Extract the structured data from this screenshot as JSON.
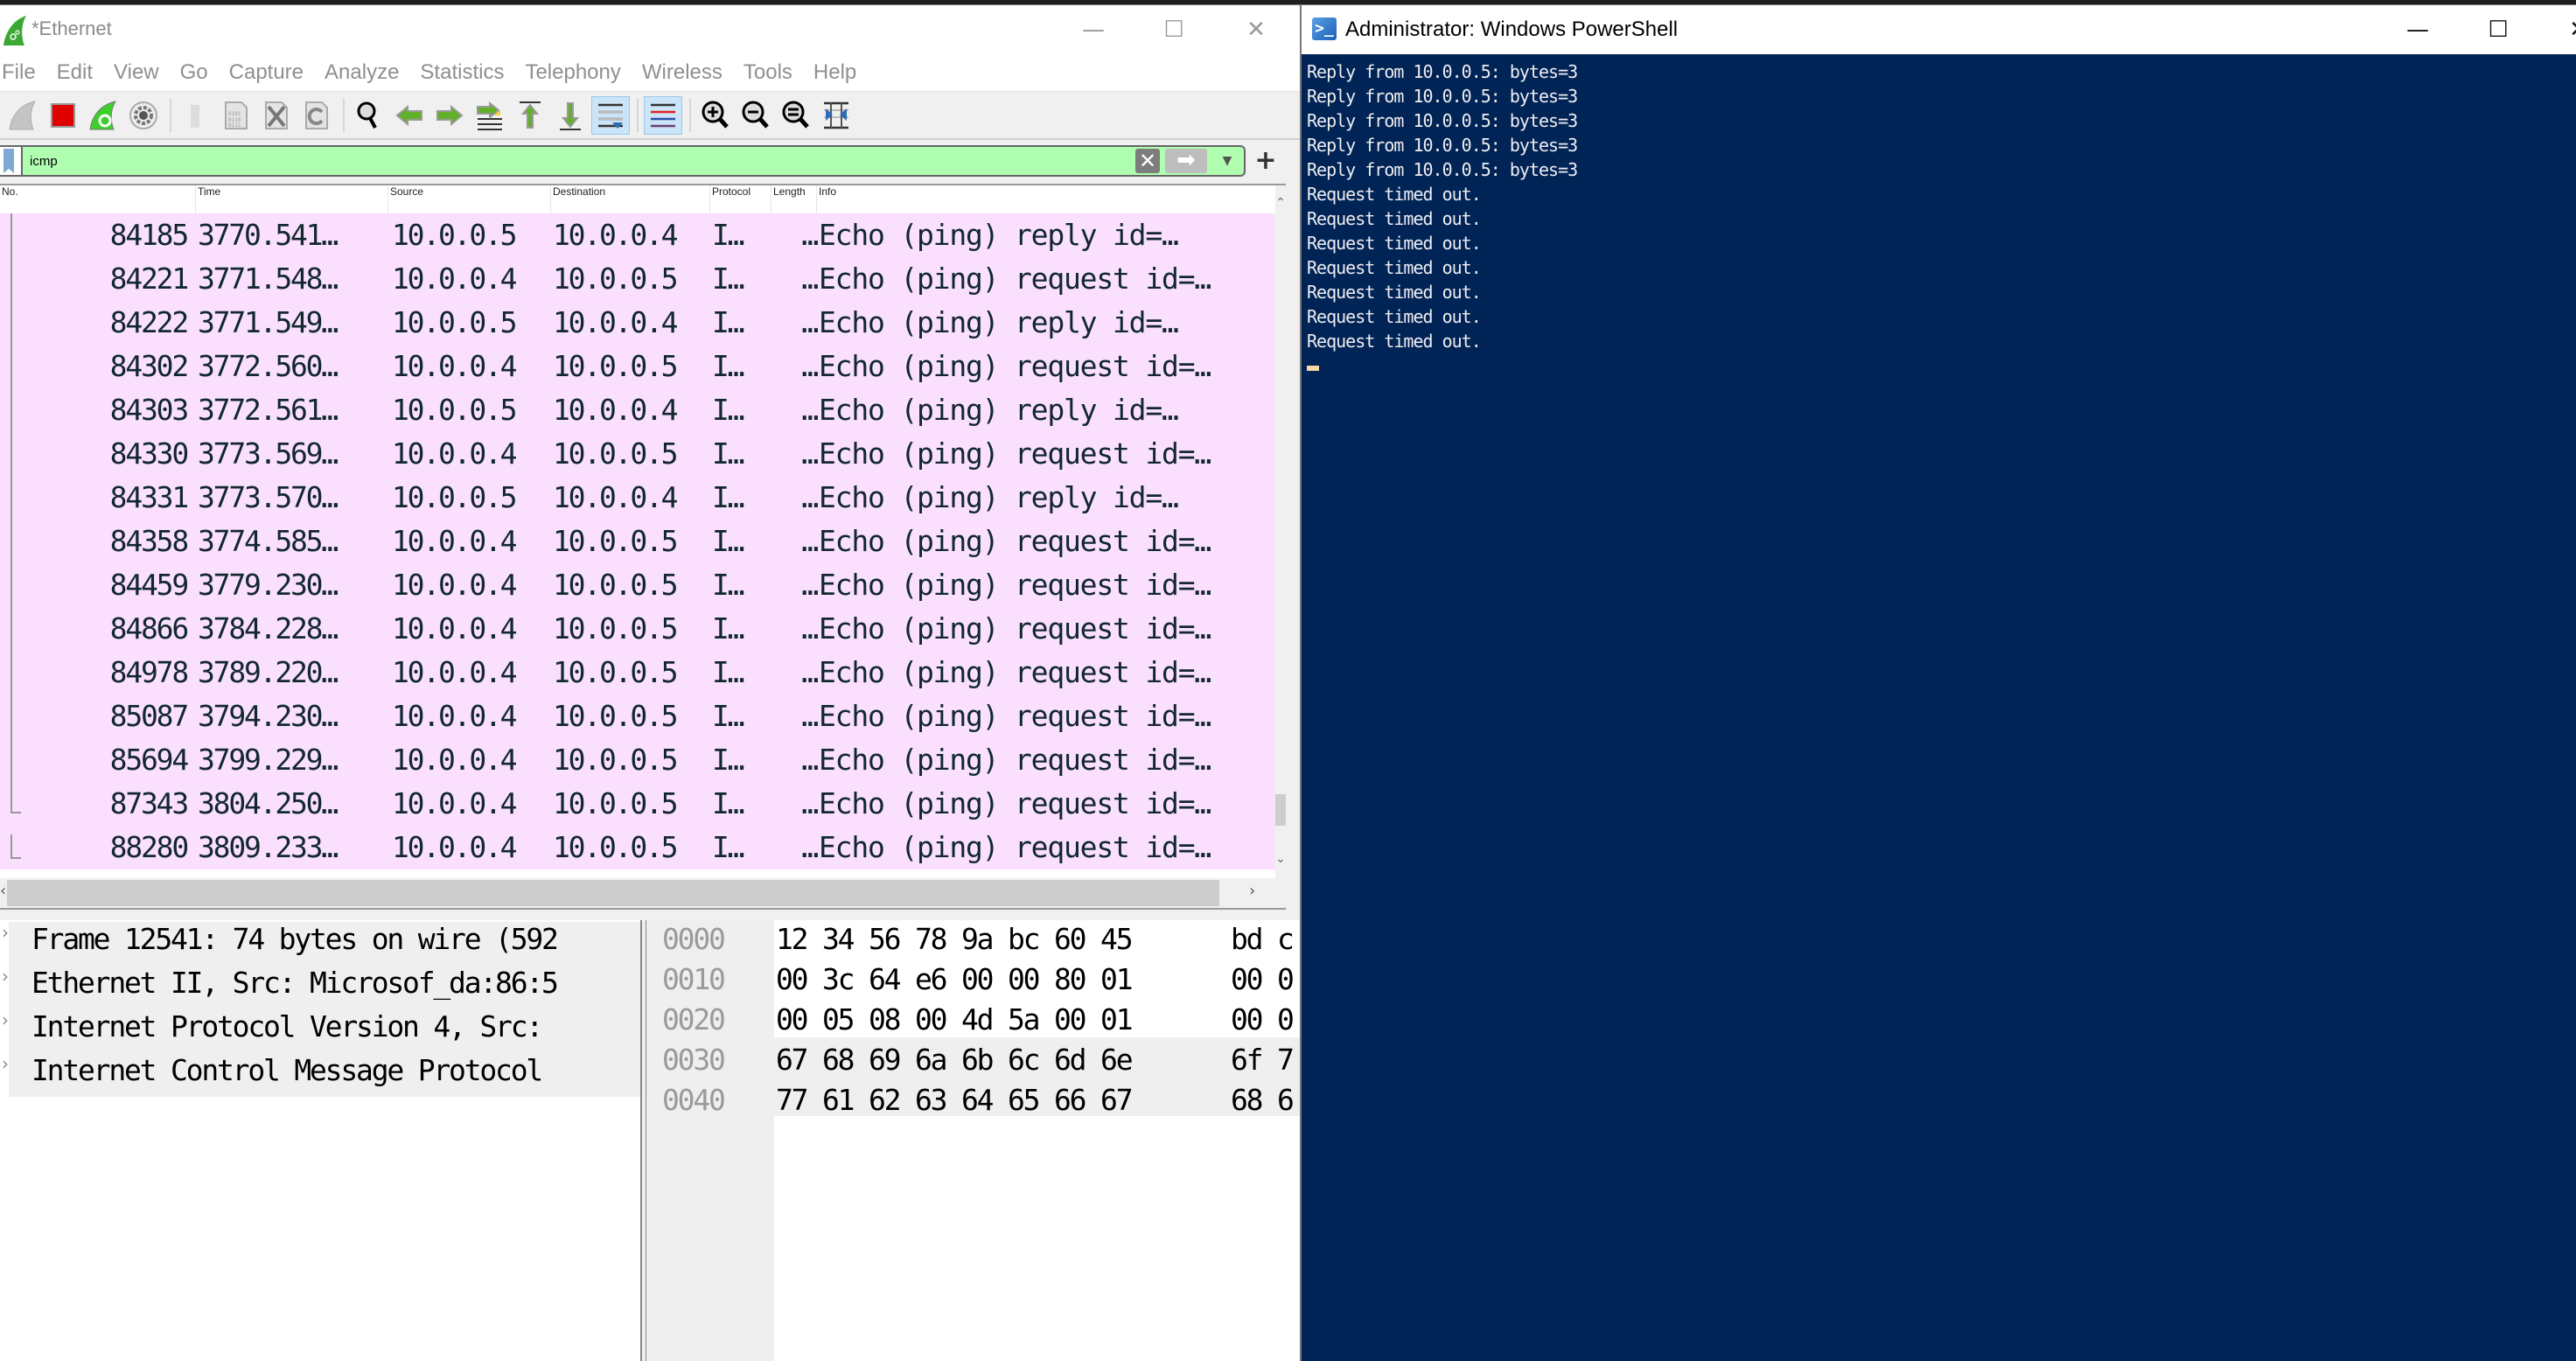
{
  "wireshark": {
    "title": "*Ethernet",
    "window_controls": {
      "minimize": "—",
      "maximize": "☐",
      "close": "✕"
    },
    "menu": [
      "File",
      "Edit",
      "View",
      "Go",
      "Capture",
      "Analyze",
      "Statistics",
      "Telephony",
      "Wireless",
      "Tools",
      "Help"
    ],
    "toolbar": [
      {
        "name": "start-capture",
        "icon": "shark-fin-icon"
      },
      {
        "name": "stop-capture",
        "icon": "stop-icon"
      },
      {
        "name": "restart-capture",
        "icon": "restart-icon"
      },
      {
        "name": "capture-options",
        "icon": "gear-icon"
      },
      {
        "name": "open-file",
        "icon": "folder-icon"
      },
      {
        "name": "save-file",
        "icon": "binary-file-icon"
      },
      {
        "name": "close-file",
        "icon": "close-file-icon"
      },
      {
        "name": "reload-file",
        "icon": "reload-icon"
      },
      {
        "name": "find-packet",
        "icon": "search-icon"
      },
      {
        "name": "go-back",
        "icon": "arrow-left-icon"
      },
      {
        "name": "go-forward",
        "icon": "arrow-right-icon"
      },
      {
        "name": "go-to-packet",
        "icon": "go-to-packet-icon"
      },
      {
        "name": "go-first",
        "icon": "arrow-up-icon"
      },
      {
        "name": "go-last",
        "icon": "arrow-down-icon"
      },
      {
        "name": "auto-scroll",
        "icon": "auto-scroll-icon",
        "active": true
      },
      {
        "name": "colorize",
        "icon": "colorize-icon",
        "active": true
      },
      {
        "name": "zoom-in",
        "icon": "zoom-in-icon"
      },
      {
        "name": "zoom-out",
        "icon": "zoom-out-icon"
      },
      {
        "name": "normal-size",
        "icon": "zoom-reset-icon"
      },
      {
        "name": "resize-columns",
        "icon": "resize-columns-icon"
      }
    ],
    "filter": {
      "value": "icmp",
      "bg_color": "#afffaf"
    },
    "columns": [
      "No.",
      "Time",
      "Source",
      "Destination",
      "Protocol",
      "Length",
      "Info"
    ],
    "row_color": "#fae0fe",
    "packets": [
      {
        "no": "84185",
        "time": "3770.541…",
        "src": "10.0.0.5",
        "dst": "10.0.0.4",
        "proto": "I…",
        "len": "…",
        "info": "Echo (ping) reply    id=…"
      },
      {
        "no": "84221",
        "time": "3771.548…",
        "src": "10.0.0.4",
        "dst": "10.0.0.5",
        "proto": "I…",
        "len": "…",
        "info": "Echo (ping) request  id=…"
      },
      {
        "no": "84222",
        "time": "3771.549…",
        "src": "10.0.0.5",
        "dst": "10.0.0.4",
        "proto": "I…",
        "len": "…",
        "info": "Echo (ping) reply    id=…"
      },
      {
        "no": "84302",
        "time": "3772.560…",
        "src": "10.0.0.4",
        "dst": "10.0.0.5",
        "proto": "I…",
        "len": "…",
        "info": "Echo (ping) request  id=…"
      },
      {
        "no": "84303",
        "time": "3772.561…",
        "src": "10.0.0.5",
        "dst": "10.0.0.4",
        "proto": "I…",
        "len": "…",
        "info": "Echo (ping) reply    id=…"
      },
      {
        "no": "84330",
        "time": "3773.569…",
        "src": "10.0.0.4",
        "dst": "10.0.0.5",
        "proto": "I…",
        "len": "…",
        "info": "Echo (ping) request  id=…"
      },
      {
        "no": "84331",
        "time": "3773.570…",
        "src": "10.0.0.5",
        "dst": "10.0.0.4",
        "proto": "I…",
        "len": "…",
        "info": "Echo (ping) reply    id=…"
      },
      {
        "no": "84358",
        "time": "3774.585…",
        "src": "10.0.0.4",
        "dst": "10.0.0.5",
        "proto": "I…",
        "len": "…",
        "info": "Echo (ping) request  id=…"
      },
      {
        "no": "84459",
        "time": "3779.230…",
        "src": "10.0.0.4",
        "dst": "10.0.0.5",
        "proto": "I…",
        "len": "…",
        "info": "Echo (ping) request  id=…"
      },
      {
        "no": "84866",
        "time": "3784.228…",
        "src": "10.0.0.4",
        "dst": "10.0.0.5",
        "proto": "I…",
        "len": "…",
        "info": "Echo (ping) request  id=…"
      },
      {
        "no": "84978",
        "time": "3789.220…",
        "src": "10.0.0.4",
        "dst": "10.0.0.5",
        "proto": "I…",
        "len": "…",
        "info": "Echo (ping) request  id=…"
      },
      {
        "no": "85087",
        "time": "3794.230…",
        "src": "10.0.0.4",
        "dst": "10.0.0.5",
        "proto": "I…",
        "len": "…",
        "info": "Echo (ping) request  id=…"
      },
      {
        "no": "85694",
        "time": "3799.229…",
        "src": "10.0.0.4",
        "dst": "10.0.0.5",
        "proto": "I…",
        "len": "…",
        "info": "Echo (ping) request  id=…"
      },
      {
        "no": "87343",
        "time": "3804.250…",
        "src": "10.0.0.4",
        "dst": "10.0.0.5",
        "proto": "I…",
        "len": "…",
        "info": "Echo (ping) request  id=…"
      },
      {
        "no": "88280",
        "time": "3809.233…",
        "src": "10.0.0.4",
        "dst": "10.0.0.5",
        "proto": "I…",
        "len": "…",
        "info": "Echo (ping) request  id=…"
      }
    ],
    "details": [
      "Frame 12541: 74 bytes on wire (592",
      "Ethernet II, Src: Microsof_da:86:5",
      "Internet Protocol Version 4, Src: ",
      "Internet Control Message Protocol"
    ],
    "bytes": [
      {
        "offset": "0000",
        "hex": "12 34 56 78 9a bc 60 45",
        "hex2": "bd c"
      },
      {
        "offset": "0010",
        "hex": "00 3c 64 e6 00 00 80 01",
        "hex2": "00 0"
      },
      {
        "offset": "0020",
        "hex": "00 05 08 00 4d 5a 00 01",
        "hex2": "00 0"
      },
      {
        "offset": "0030",
        "hex": "67 68 69 6a 6b 6c 6d 6e",
        "hex2": "6f 7"
      },
      {
        "offset": "0040",
        "hex": "77 61 62 63 64 65 66 67",
        "hex2": "68 6"
      }
    ]
  },
  "powershell": {
    "title": "Administrator: Windows PowerShell",
    "window_controls": {
      "minimize": "—",
      "maximize": "☐",
      "close": "✕"
    },
    "bg_color": "#012456",
    "lines": [
      "Reply from 10.0.0.5: bytes=3",
      "Reply from 10.0.0.5: bytes=3",
      "Reply from 10.0.0.5: bytes=3",
      "Reply from 10.0.0.5: bytes=3",
      "Reply from 10.0.0.5: bytes=3",
      "Request timed out.",
      "Request timed out.",
      "Request timed out.",
      "Request timed out.",
      "Request timed out.",
      "Request timed out.",
      "Request timed out."
    ]
  }
}
